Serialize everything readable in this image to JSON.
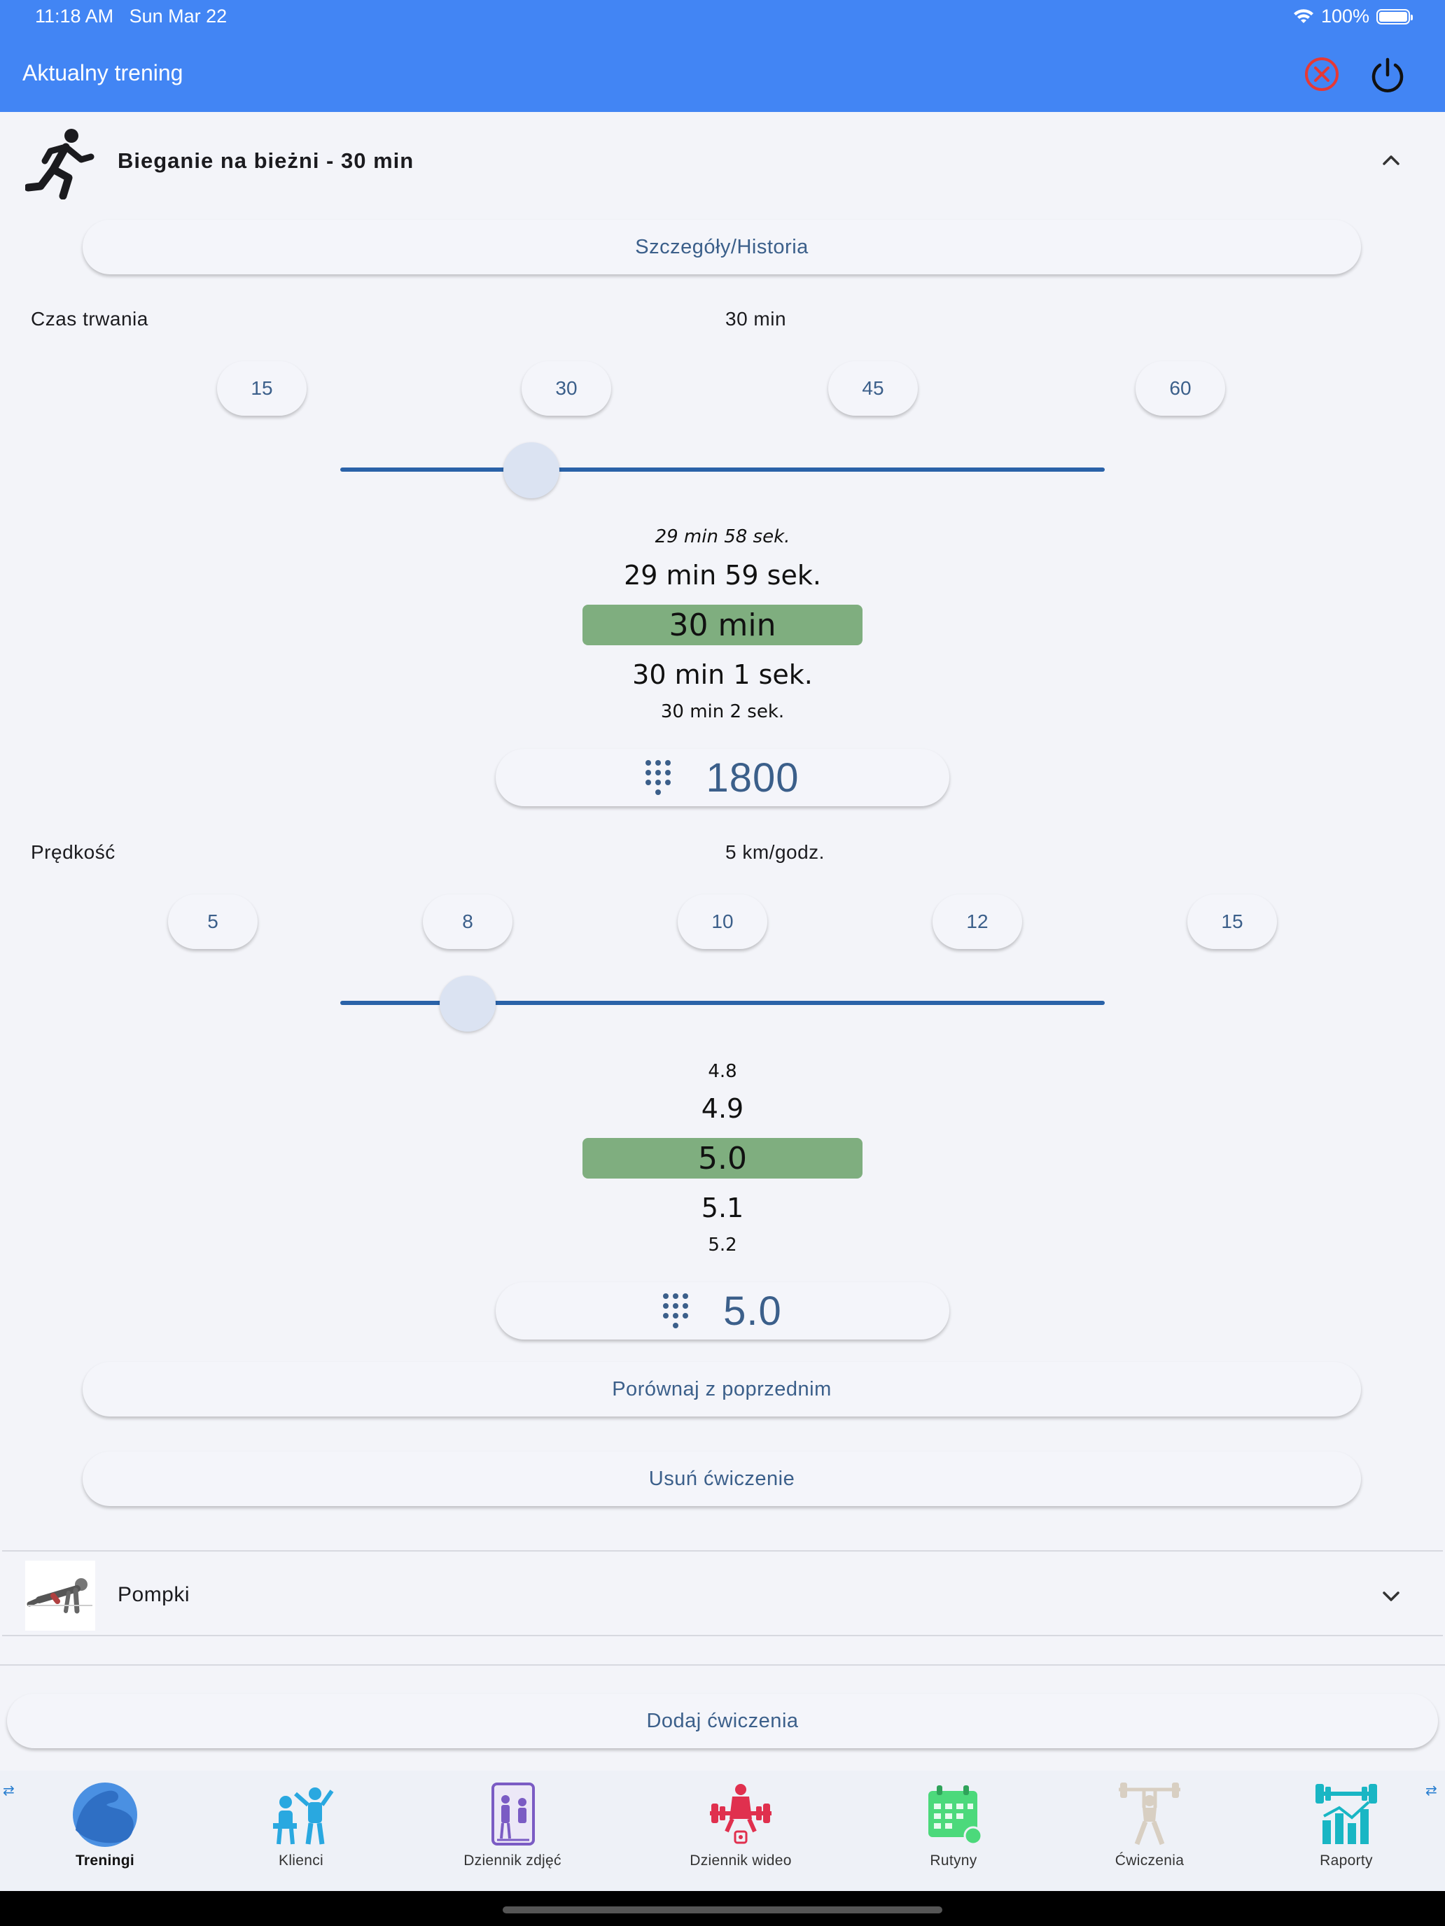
{
  "status_bar": {
    "time": "11:18 AM",
    "date": "Sun Mar 22",
    "battery": "100%"
  },
  "header": {
    "title": "Aktualny trening"
  },
  "exercises": [
    {
      "name": "Bieganie na bieżni - 30 min",
      "expanded": true,
      "details_label": "Szczegóły/Historia",
      "duration": {
        "label": "Czas trwania",
        "value_text": "30 min",
        "presets": [
          "15",
          "30",
          "45",
          "60"
        ],
        "slider_value_min": 30,
        "slider_range_min": [
          0,
          120
        ],
        "wheel": [
          "29 min 58 sek.",
          "29 min 59 sek.",
          "30 min",
          "30 min 1 sek.",
          "30 min 2 sek."
        ],
        "input_value": "1800"
      },
      "speed": {
        "label": "Prędkość",
        "value_text": "5 km/godz.",
        "presets": [
          "5",
          "8",
          "10",
          "12",
          "15"
        ],
        "slider_value": 5,
        "slider_range": [
          0,
          30
        ],
        "wheel": [
          "4.8",
          "4.9",
          "5.0",
          "5.1",
          "5.2"
        ],
        "input_value": "5.0"
      },
      "compare_label": "Porównaj z poprzednim",
      "remove_label": "Usuń ćwiczenie"
    },
    {
      "name": "Pompki",
      "expanded": false
    }
  ],
  "add_exercises_label": "Dodaj ćwiczenia",
  "bottom_nav": [
    {
      "label": "Treningi",
      "icon": "muscle-arm-icon",
      "active": true
    },
    {
      "label": "Klienci",
      "icon": "trainer-client-icon",
      "active": false
    },
    {
      "label": "Dziennik zdjęć",
      "icon": "photo-journal-icon",
      "active": false
    },
    {
      "label": "Dziennik wideo",
      "icon": "video-journal-icon",
      "active": false
    },
    {
      "label": "Rutyny",
      "icon": "calendar-routine-icon",
      "active": false
    },
    {
      "label": "Ćwiczenia",
      "icon": "weightlifter-icon",
      "active": false
    },
    {
      "label": "Raporty",
      "icon": "chart-report-icon",
      "active": false
    }
  ],
  "colors": {
    "header": "#4285f4",
    "selection": "#7fae7f",
    "accent_text": "#3b5f8a",
    "slider": "#2a62a8",
    "close_icon": "#e53935"
  }
}
